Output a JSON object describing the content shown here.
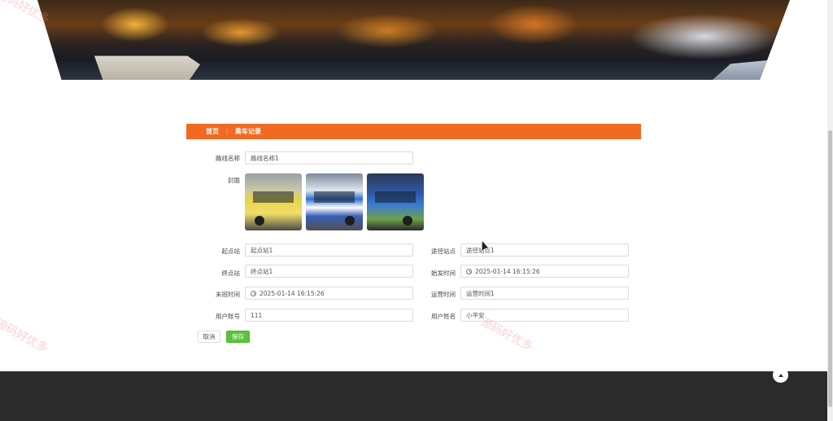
{
  "breadcrumb": {
    "home": "首页",
    "separator": "⋮",
    "current": "乘车记录"
  },
  "form": {
    "route_name": {
      "label": "路线名称",
      "value": "路线名称1"
    },
    "cover": {
      "label": "封面"
    },
    "start_station": {
      "label": "起点站",
      "value": "起点站1"
    },
    "via_stations": {
      "label": "途径站点",
      "value": "途径站点1"
    },
    "end_station": {
      "label": "终点站",
      "value": "终点站1"
    },
    "first_bus_time": {
      "label": "始发时间",
      "value": "2025-01-14 16:15:26"
    },
    "last_bus_time": {
      "label": "末班时间",
      "value": "2025-01-14 16:15:26"
    },
    "operating_hours": {
      "label": "运营时间",
      "value": "运营时间1"
    },
    "user_account": {
      "label": "用户账号",
      "value": "111"
    },
    "user_name": {
      "label": "用户姓名",
      "value": "小平安"
    }
  },
  "buttons": {
    "cancel": "取消",
    "save": "保存"
  },
  "watermark": {
    "text": "源码好优多"
  },
  "icons": {
    "clock": "clock-icon",
    "back_to_top": "arrow-up-icon"
  },
  "colors": {
    "accent": "#f06a22",
    "save": "#5cc23c",
    "footer": "#2b2b2b"
  }
}
